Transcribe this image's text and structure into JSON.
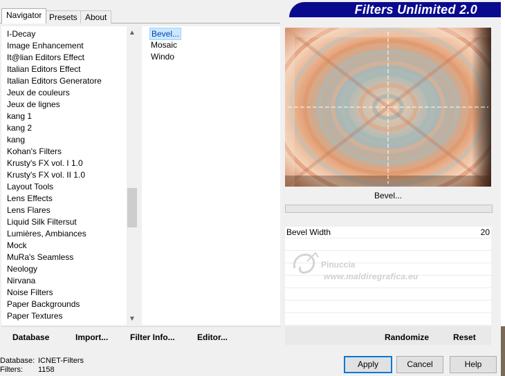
{
  "tabs": [
    "Navigator",
    "Presets",
    "About"
  ],
  "banner_title": "Filters Unlimited 2.0",
  "categories": [
    "I-Decay",
    "Image Enhancement",
    "It@lian Editors Effect",
    "Italian Editors Effect",
    "Italian Editors Generatore",
    "Jeux de couleurs",
    "Jeux de lignes",
    "kang 1",
    "kang 2",
    "kang",
    "Kohan's Filters",
    "Krusty's FX vol. I 1.0",
    "Krusty's FX vol. II 1.0",
    "Layout Tools",
    "Lens Effects",
    "Lens Flares",
    "Liquid Silk Filtersut",
    "Lumières, Ambiances",
    "Mock",
    "MuRa's Seamless",
    "Neology",
    "Nirvana",
    "Noise Filters",
    "Paper Backgrounds",
    "Paper Textures"
  ],
  "filters": [
    "Bevel...",
    "Mosaic",
    "Windo"
  ],
  "selected_filter": "Bevel...",
  "left_buttons": {
    "database": "Database",
    "import": "Import...",
    "filter_info": "Filter Info...",
    "editor": "Editor..."
  },
  "preview_label": "Bevel...",
  "parameter": {
    "name": "Bevel Width",
    "value": "20"
  },
  "right_buttons": {
    "randomize": "Randomize",
    "reset": "Reset"
  },
  "watermark": {
    "line1": "Pinuccia",
    "line2": "www.maldiregrafica.eu"
  },
  "status": {
    "database_label": "Database:",
    "database_value": "ICNET-Filters",
    "filters_label": "Filters:",
    "filters_value": "1158"
  },
  "dialog_buttons": {
    "apply": "Apply",
    "cancel": "Cancel",
    "help": "Help"
  },
  "colors": {
    "banner": "#0a0a8f",
    "selection": "#cce8ff",
    "default_button_border": "#0078d7"
  }
}
